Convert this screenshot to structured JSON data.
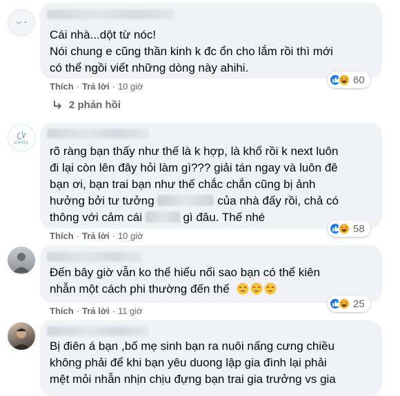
{
  "actions": {
    "like_label": "Thích",
    "reply_label": "Trả lời",
    "separator": "·"
  },
  "colors": {
    "bubble": "#f0f2f5",
    "meta_text": "#65676b",
    "like_blue": "#1877f2",
    "haha_yellow": "#f7b125"
  },
  "comments": [
    {
      "lines": [
        "Cái nhà...dột từ nóc!",
        "Nói chung e cũng thần kinh k đc ổn cho lắm rồi thì mới",
        "có thể ngồi viết những dòng này ahihi."
      ],
      "time": "10 giờ",
      "reactions": [
        "like-icon",
        "haha-icon"
      ],
      "reaction_count": "60",
      "replies_label": "2 phản hồi"
    },
    {
      "avatar_text": "CHIRA",
      "lines": [
        "rõ ràng bạn thấy như thế là k hợp, là khổ rồi k next luôn",
        "đi lại còn lên đây hỏi làm gì??? giải tán ngay và luôn đê",
        "bạn ơi, bạn trai bạn như thế chắc chắn cũng bị ảnh"
      ],
      "line4_start": "hưởng bởi tư tưởng",
      "line4_end": "của nhà đấy rồi, chả có",
      "line5_start": "thông với cảm cái",
      "line5_end": "gì đâu. Thế nhé",
      "time": "10 giờ",
      "reactions": [
        "like-icon",
        "haha-icon"
      ],
      "reaction_count": "58"
    },
    {
      "lines": [
        "Đến bây giờ vẫn ko thể hiểu nổi sao bạn có thể kiên",
        "nhẫn một cách phi thường đến thế"
      ],
      "emoji": [
        "unamused-face",
        "unamused-face",
        "unamused-face"
      ],
      "time": "11 giờ",
      "reactions": [
        "like-icon",
        "haha-icon"
      ],
      "reaction_count": "25"
    },
    {
      "lines": [
        "Bị điên á bạn ,bố mẹ sinh bạn ra nuôi nấng cưng chiều",
        "không phải để khi bạn yêu duong lập gia đình lại phải",
        "mệt mỏi nhẫn nhịn chịu đựng bạn trai gia trưởng vs gia"
      ]
    }
  ]
}
